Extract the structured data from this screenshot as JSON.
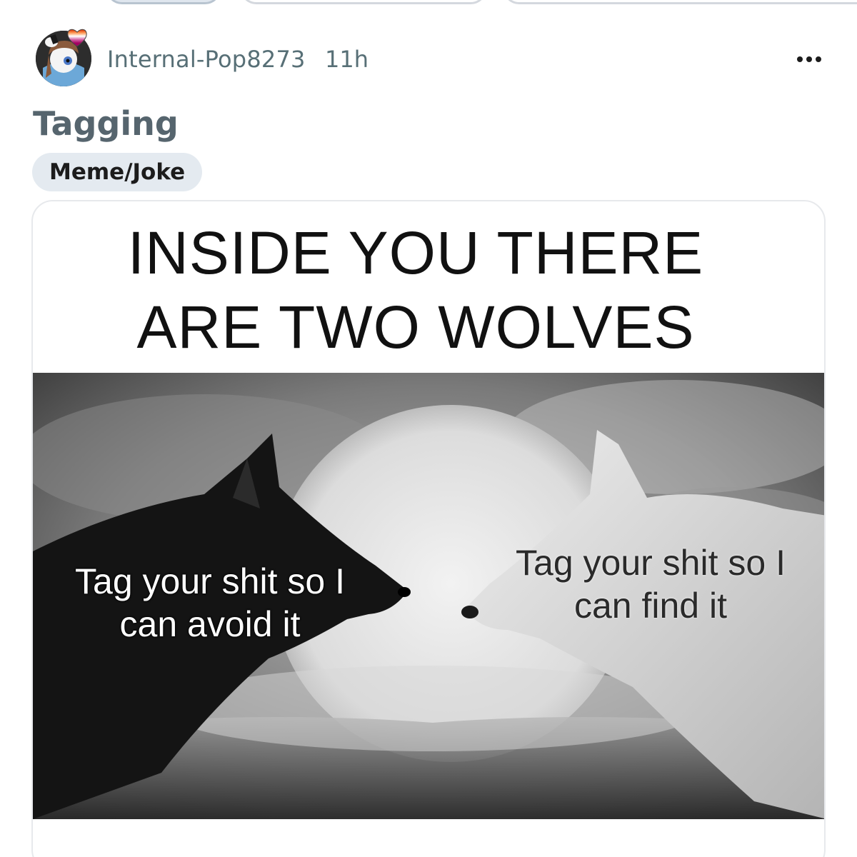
{
  "post": {
    "username": "Internal-Pop8273",
    "time_ago": "11h",
    "title": "Tagging",
    "flair": "Meme/Joke"
  },
  "meme": {
    "caption_line1": "INSIDE YOU THERE",
    "caption_line2": "ARE TWO WOLVES",
    "left_wolf_text": "Tag your shit so I can avoid it",
    "right_wolf_text": "Tag your shit so I can find it"
  },
  "icons": {
    "more": "more-horizontal-icon",
    "avatar": "user-avatar",
    "flair": "pride-heart-icon"
  },
  "colors": {
    "meta_text": "#576f76",
    "title_text": "#56656e",
    "flair_bg": "#e4eaf0"
  }
}
